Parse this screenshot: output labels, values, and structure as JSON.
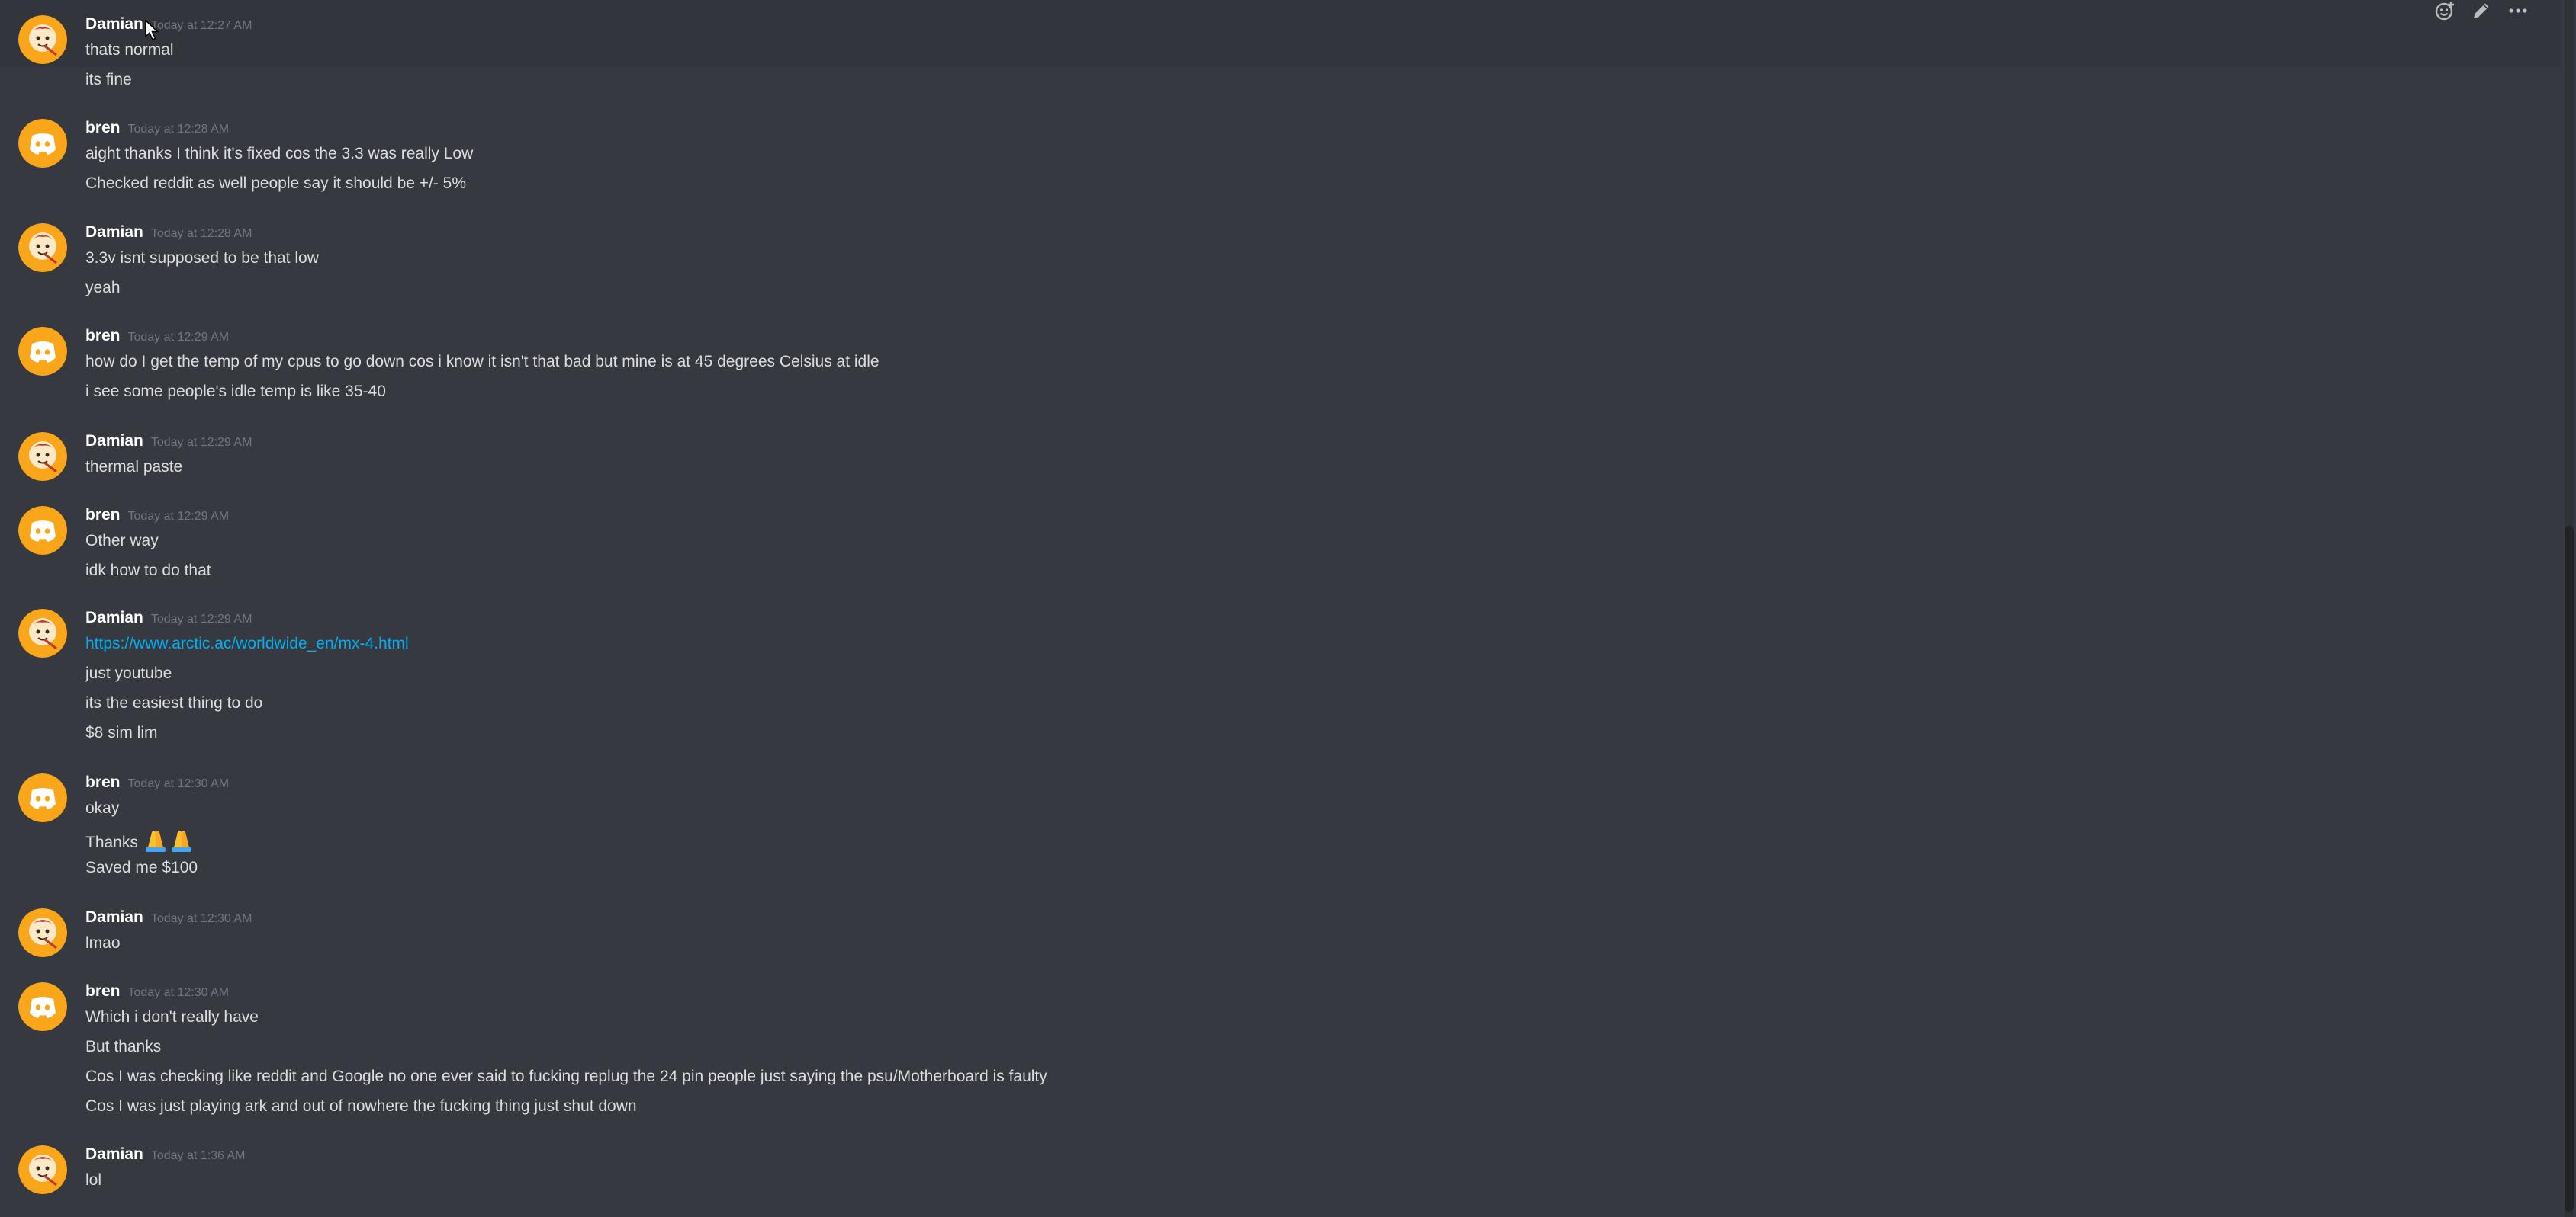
{
  "users": {
    "damian": {
      "name": "Damian",
      "avatar_icon": "damian-avatar-icon",
      "avatar_color": "#faa61a"
    },
    "bren": {
      "name": "bren",
      "avatar_icon": "discord-default-avatar-icon",
      "avatar_color": "#faa61a"
    }
  },
  "toolbar": {
    "icons": [
      "add-reaction-icon",
      "edit-pencil-icon",
      "more-options-icon"
    ]
  },
  "messages": [
    {
      "author": "Damian",
      "timestamp": "Today at 12:27 AM",
      "lines": [
        "thats normal",
        "its fine"
      ]
    },
    {
      "author": "bren",
      "timestamp": "Today at 12:28 AM",
      "lines": [
        "aight thanks I think it's fixed cos the 3.3 was really Low",
        "Checked reddit as well people say it should be +/- 5%"
      ]
    },
    {
      "author": "Damian",
      "timestamp": "Today at 12:28 AM",
      "lines": [
        "3.3v isnt supposed to be that low",
        "yeah"
      ]
    },
    {
      "author": "bren",
      "timestamp": "Today at 12:29 AM",
      "lines": [
        "how do I get the temp of my cpus to go down cos i know it isn't that bad but mine is at 45 degrees Celsius at idle",
        "i see some people's idle temp is like 35-40"
      ]
    },
    {
      "author": "Damian",
      "timestamp": "Today at 12:29 AM",
      "lines": [
        "thermal paste"
      ]
    },
    {
      "author": "bren",
      "timestamp": "Today at 12:29 AM",
      "lines": [
        "Other way",
        "idk how to do that"
      ]
    },
    {
      "author": "Damian",
      "timestamp": "Today at 12:29 AM",
      "link": "https://www.arctic.ac/worldwide_en/mx-4.html",
      "lines": [
        "just youtube",
        "its the easiest thing to do",
        "$8 sim lim"
      ]
    },
    {
      "author": "bren",
      "timestamp": "Today at 12:30 AM",
      "lines": [
        "okay",
        "Thanks",
        "Saved me $100"
      ],
      "emoji": "folded-hands-emoji-icon"
    },
    {
      "author": "Damian",
      "timestamp": "Today at 12:30 AM",
      "lines": [
        "lmao"
      ]
    },
    {
      "author": "bren",
      "timestamp": "Today at 12:30 AM",
      "lines": [
        "Which i don't really have",
        "But thanks",
        "Cos I was checking like reddit and Google no one ever said to fucking replug the 24 pin people just saying the psu/Motherboard is faulty",
        "Cos I was just playing ark and out of nowhere the fucking thing just shut down"
      ]
    },
    {
      "author": "Damian",
      "timestamp": "Today at 1:36 AM",
      "lines": [
        "lol"
      ]
    }
  ],
  "colors": {
    "background": "#36393f",
    "text": "#dcddde",
    "username": "#ffffff",
    "timestamp": "#72767d",
    "link": "#00aff4",
    "avatar": "#faa61a"
  }
}
